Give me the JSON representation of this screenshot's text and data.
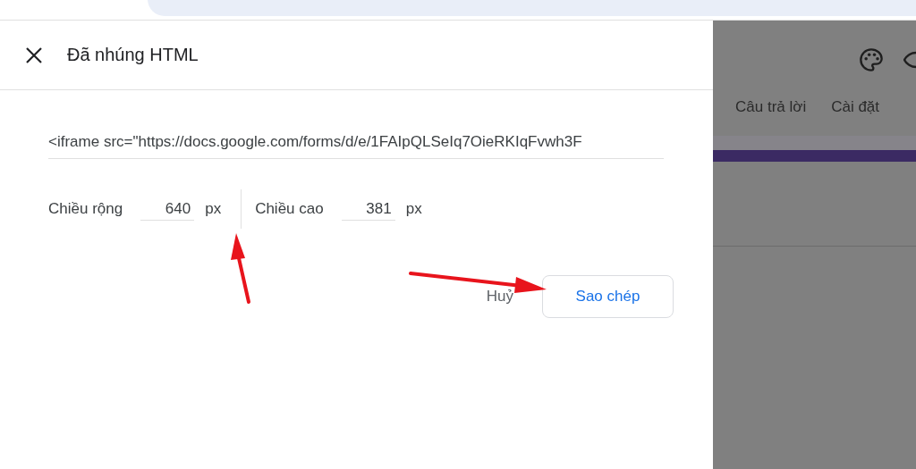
{
  "dialog": {
    "title": "Đã nhúng HTML",
    "embed_code": "<iframe src=\"https://docs.google.com/forms/d/e/1FAIpQLSeIq7OieRKIqFvwh3F",
    "size_fields": [
      {
        "label": "Chiều rộng",
        "value": "640",
        "unit": "px"
      },
      {
        "label": "Chiều cao",
        "value": "381",
        "unit": "px"
      }
    ],
    "buttons": [
      {
        "label": "Huỷ",
        "kind": "text"
      },
      {
        "label": "Sao chép",
        "kind": "outlined"
      }
    ]
  },
  "background": {
    "tabs": [
      {
        "label": "Câu trả lời",
        "selected": false
      },
      {
        "label": "Cài đặt",
        "selected": false
      }
    ]
  }
}
